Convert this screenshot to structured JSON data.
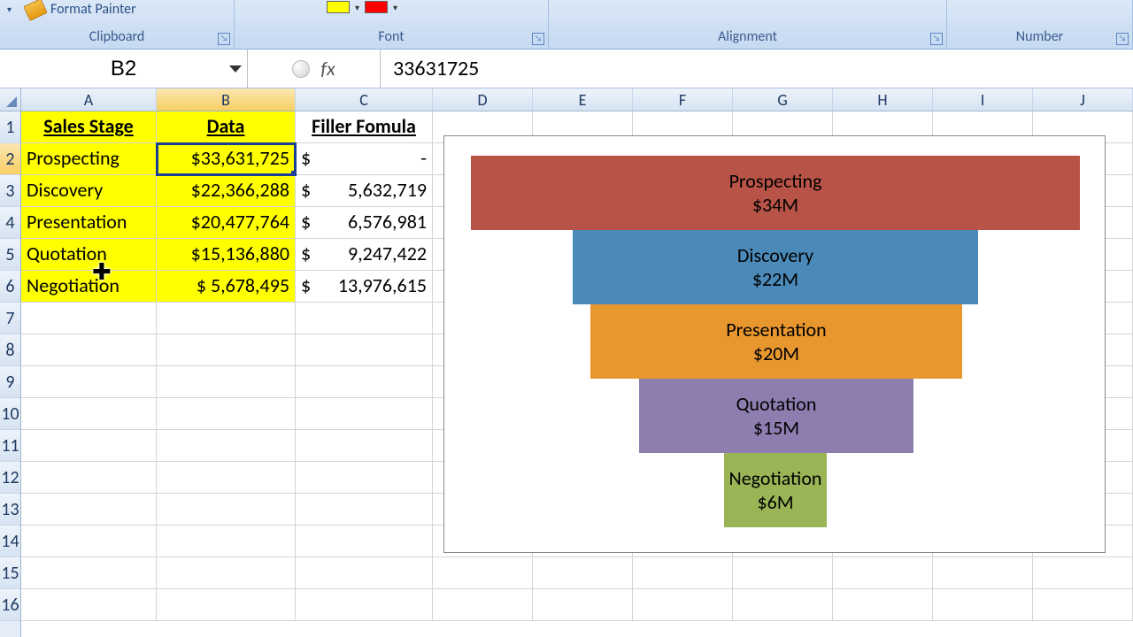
{
  "ribbon": {
    "format_painter": "Format Painter",
    "groups": [
      "Clipboard",
      "Font",
      "Alignment",
      "Number"
    ]
  },
  "namebox": "B2",
  "formula": "33631725",
  "columns": [
    "A",
    "B",
    "C",
    "D",
    "E",
    "F",
    "G",
    "H",
    "I",
    "J"
  ],
  "rows": [
    "1",
    "2",
    "3",
    "4",
    "5",
    "6",
    "7",
    "8",
    "9",
    "10",
    "11",
    "12",
    "13",
    "14",
    "15",
    "16"
  ],
  "table": {
    "headers": [
      "Sales Stage",
      "Data",
      "Filler Fomula"
    ],
    "rows": [
      {
        "stage": "Prospecting",
        "data": "$33,631,725",
        "filler_cur": "$",
        "filler_val": "-"
      },
      {
        "stage": "Discovery",
        "data": "$22,366,288",
        "filler_cur": "$",
        "filler_val": "5,632,719"
      },
      {
        "stage": "Presentation",
        "data": "$20,477,764",
        "filler_cur": "$",
        "filler_val": "6,576,981"
      },
      {
        "stage": "Quotation",
        "data": "$15,136,880",
        "filler_cur": "$",
        "filler_val": "9,247,422"
      },
      {
        "stage": "Negotiation",
        "data": "$  5,678,495",
        "filler_cur": "$",
        "filler_val": "13,976,615"
      }
    ]
  },
  "chart_data": {
    "type": "bar",
    "title": "",
    "categories": [
      "Prospecting",
      "Discovery",
      "Presentation",
      "Quotation",
      "Negotiation"
    ],
    "values": [
      33631725,
      22366288,
      20477764,
      15136880,
      5678495
    ],
    "value_labels": [
      "$34M",
      "$22M",
      "$20M",
      "$15M",
      "$6M"
    ],
    "colors": [
      "#b85347",
      "#4a89b8",
      "#e8972f",
      "#8e7eb0",
      "#99b556"
    ]
  },
  "chart_display": {
    "bars": [
      {
        "name": "Prospecting",
        "amt": "$34M"
      },
      {
        "name": "Discovery",
        "amt": "$22M"
      },
      {
        "name": "Presentation",
        "amt": "$20M"
      },
      {
        "name": "Quotation",
        "amt": "$15M"
      },
      {
        "name": "Negotiation",
        "amt": "$6M"
      }
    ]
  }
}
